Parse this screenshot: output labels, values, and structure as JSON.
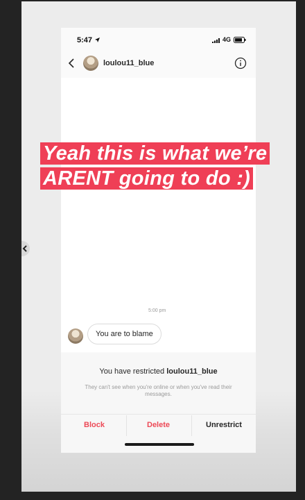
{
  "status": {
    "time": "5:47",
    "network": "4G"
  },
  "header": {
    "username": "loulou11_blue"
  },
  "overlay": {
    "line1": "Yeah this is what we’re",
    "line2": "ARENT going to do :)"
  },
  "chat": {
    "timestamp": "5:00 pm",
    "message": "You are to blame"
  },
  "restrict": {
    "title_prefix": "You have restricted ",
    "username": "loulou11_blue",
    "subtitle": "They can't see when you're online or when you've read their messages."
  },
  "actions": {
    "block": "Block",
    "delete": "Delete",
    "unrestrict": "Unrestrict"
  },
  "colors": {
    "overlay_bg": "#ef3f56",
    "danger": "#ed4956"
  }
}
